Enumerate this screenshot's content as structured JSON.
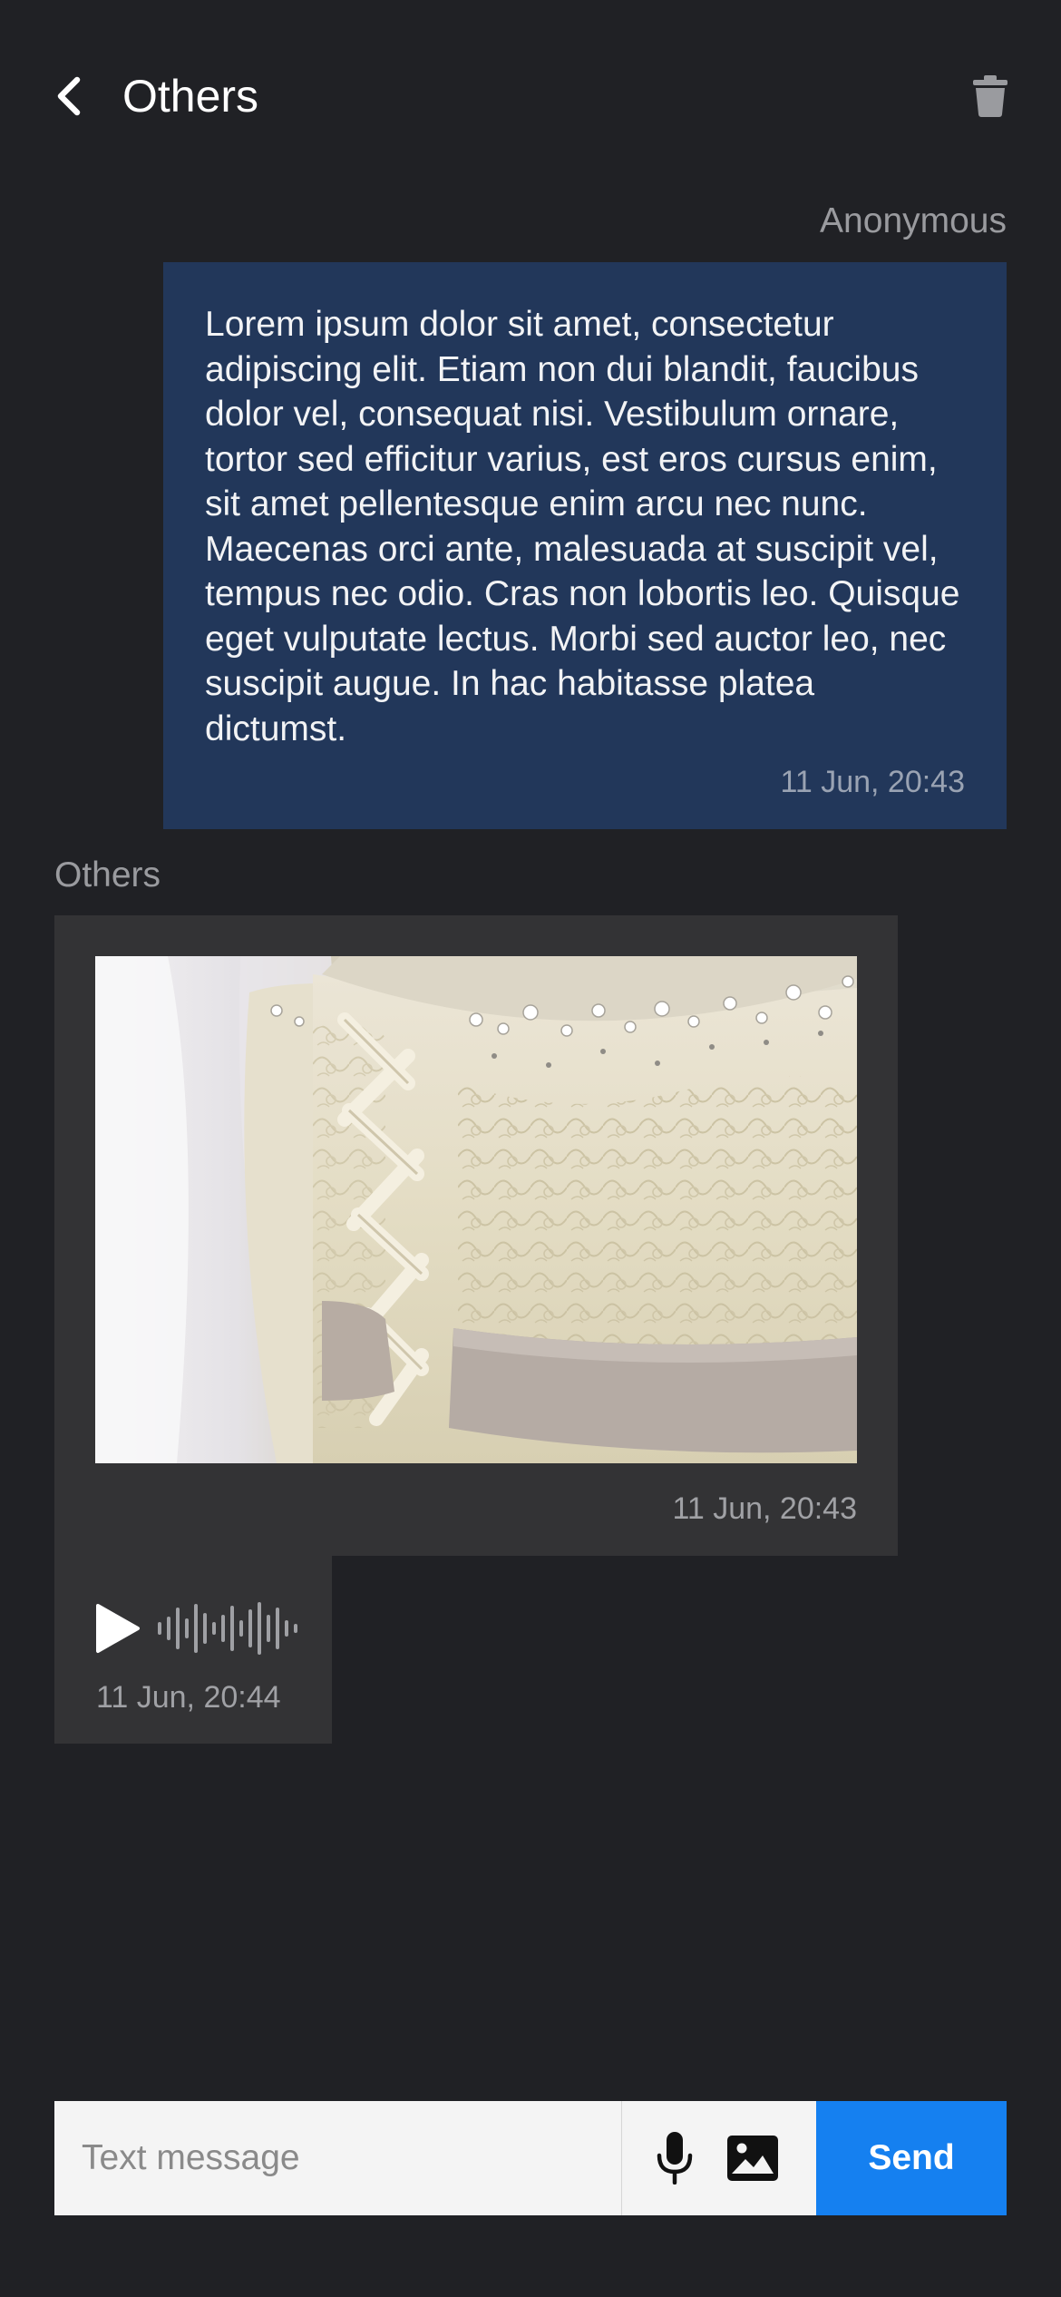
{
  "header": {
    "title": "Others",
    "back_icon": "chevron-left-icon",
    "delete_icon": "trash-icon"
  },
  "messages": [
    {
      "sender": "Anonymous",
      "type": "text",
      "text": "Lorem ipsum dolor sit amet, consectetur adipiscing elit. Etiam non dui blandit, faucibus dolor vel, consequat nisi. Vestibulum ornare, tortor sed efficitur varius, est eros cursus enim, sit amet pellentesque enim arcu nec nunc. Maecenas orci ante, malesuada at suscipit vel, tempus nec odio. Cras non lobortis leo. Quisque eget vulputate lectus. Morbi sed auctor leo, nec suscipit augue. In hac habitasse platea dictumst.",
      "time": "11 Jun, 20:43"
    },
    {
      "sender": "Others",
      "type": "image",
      "image_subject": "wedding-dress-corset-photo",
      "time": "11 Jun, 20:43"
    },
    {
      "type": "audio",
      "time": "11 Jun, 20:44"
    }
  ],
  "composer": {
    "placeholder": "Text message",
    "value": "",
    "mic_icon": "microphone-icon",
    "image_icon": "image-icon",
    "send_label": "Send"
  },
  "colors": {
    "background": "#202125",
    "my_bubble": "#22375a",
    "other_bubble": "#333335",
    "send_button": "#1580f0"
  }
}
